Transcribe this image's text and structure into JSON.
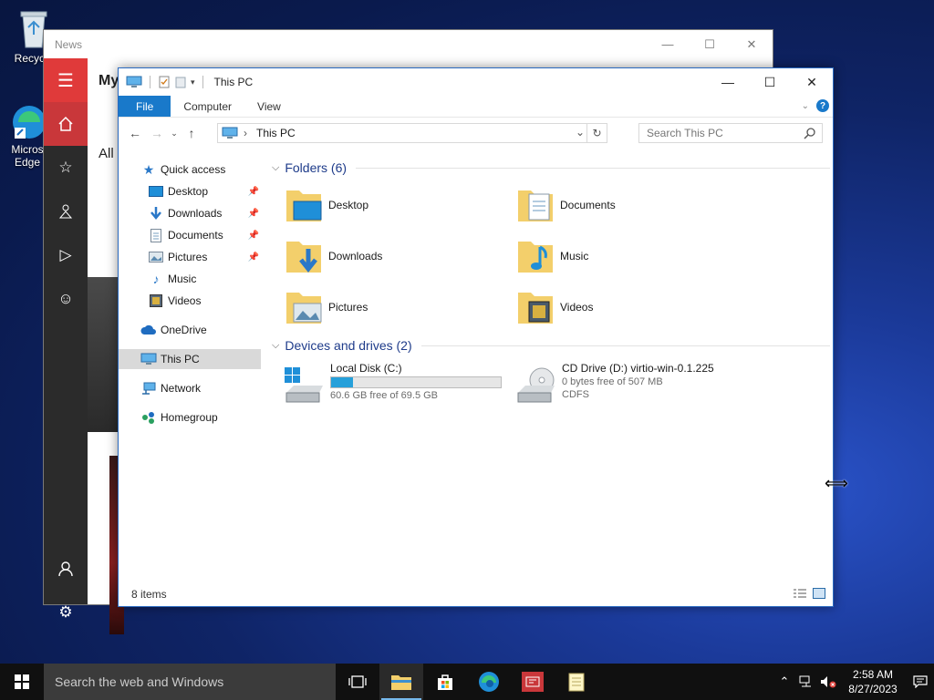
{
  "desktop": {
    "icons": [
      {
        "label": "Recycle"
      },
      {
        "label": "Micros Edge"
      }
    ]
  },
  "news": {
    "title": "News",
    "heading": "My",
    "filter": "All"
  },
  "explorer": {
    "title": "This PC",
    "ribbon_tabs": [
      "File",
      "Computer",
      "View"
    ],
    "address": "This PC",
    "search_placeholder": "Search This PC",
    "nav": {
      "quick_access": "Quick access",
      "items": [
        "Desktop",
        "Downloads",
        "Documents",
        "Pictures",
        "Music",
        "Videos"
      ],
      "onedrive": "OneDrive",
      "this_pc": "This PC",
      "network": "Network",
      "homegroup": "Homegroup"
    },
    "folders_header": "Folders (6)",
    "folders": [
      "Desktop",
      "Documents",
      "Downloads",
      "Music",
      "Pictures",
      "Videos"
    ],
    "drives_header": "Devices and drives (2)",
    "drives": [
      {
        "name": "Local Disk (C:)",
        "free": "60.6 GB free of 69.5 GB",
        "used_fraction": 0.128
      },
      {
        "name": "CD Drive (D:) virtio-win-0.1.225",
        "free": "0 bytes free of 507 MB",
        "fs": "CDFS"
      }
    ],
    "status": "8 items"
  },
  "taskbar": {
    "search_placeholder": "Search the web and Windows",
    "time": "2:58 AM",
    "date": "8/27/2023"
  },
  "colors": {
    "accent": "#1979ca",
    "news_red": "#e03a3a",
    "drive_bar": "#26a0da"
  }
}
